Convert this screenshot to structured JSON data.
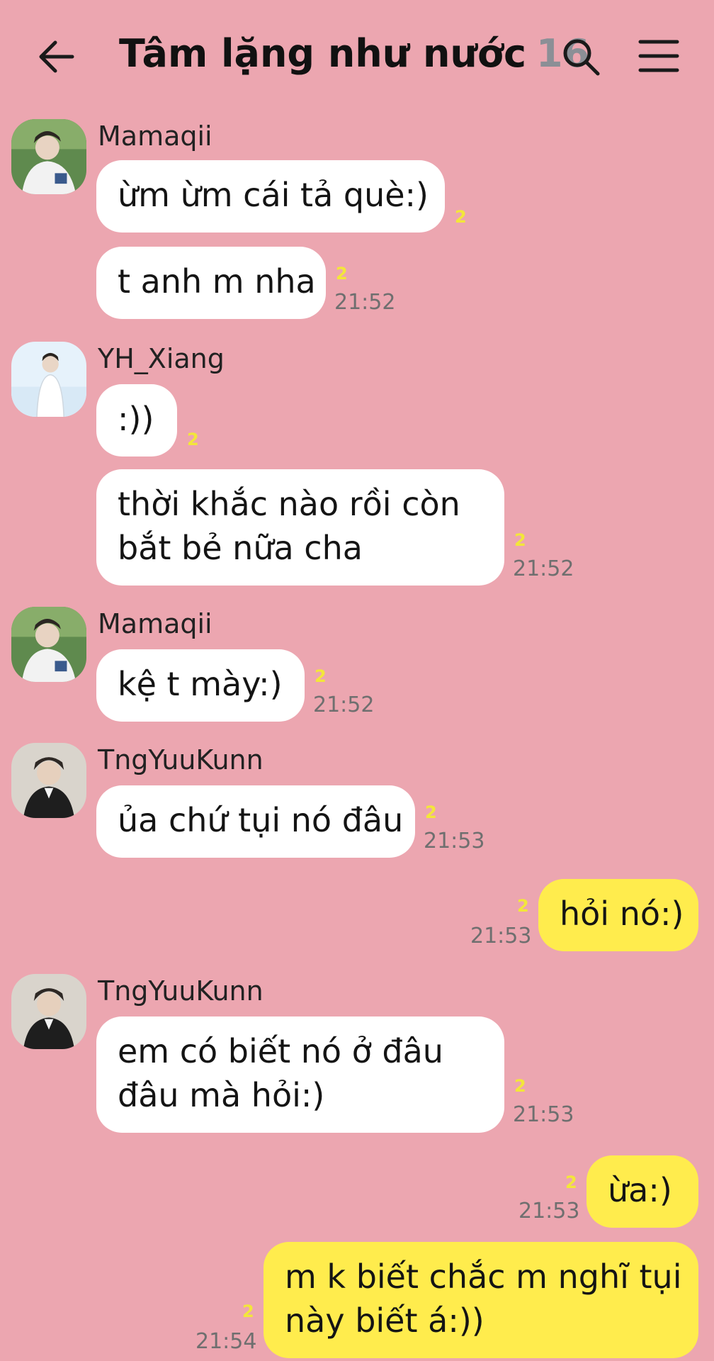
{
  "header": {
    "title": "Tâm lặng như nước",
    "member_count": "16"
  },
  "messages": [
    {
      "sender": "Mamaqii",
      "lines": [
        "ừm ừm cái tả què:)"
      ],
      "read": "2",
      "time": ""
    },
    {
      "sender": "",
      "lines": [
        "t anh m nha"
      ],
      "read": "2",
      "time": "21:52"
    },
    {
      "sender": "YH_Xiang",
      "lines": [
        ":))"
      ],
      "read": "2",
      "time": ""
    },
    {
      "sender": "",
      "lines": [
        "thời khắc nào rồi còn",
        "bắt bẻ nữa cha"
      ],
      "read": "2",
      "time": "21:52"
    },
    {
      "sender": "Mamaqii",
      "lines": [
        "kệ t mày:)"
      ],
      "read": "2",
      "time": "21:52"
    },
    {
      "sender": "TngYuuKunn",
      "lines": [
        "ủa chứ tụi nó đâu"
      ],
      "read": "2",
      "time": "21:53"
    },
    {
      "sender": "me",
      "lines": [
        "hỏi nó:)"
      ],
      "read": "2",
      "time": "21:53"
    },
    {
      "sender": "TngYuuKunn",
      "lines": [
        "em có biết nó ở đâu",
        "đâu mà hỏi:)"
      ],
      "read": "2",
      "time": "21:53"
    },
    {
      "sender": "me",
      "lines": [
        "ừa:)"
      ],
      "read": "2",
      "time": "21:53"
    },
    {
      "sender": "me",
      "lines": [
        "m k biết chắc m nghĩ tụi",
        "này biết á:))"
      ],
      "read": "2",
      "time": "21:54"
    }
  ],
  "colors": {
    "background": "#eca6b0",
    "incoming_bubble": "#ffffff",
    "outgoing_bubble": "#ffec4d",
    "read_count": "#f3e63a"
  },
  "icons": {
    "back": "arrow-left-icon",
    "search": "search-icon",
    "menu": "hamburger-menu-icon"
  }
}
